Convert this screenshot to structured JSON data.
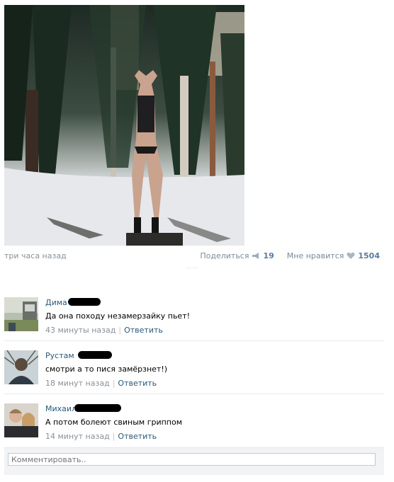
{
  "post": {
    "photo_icon": "forest-photo",
    "time": "три часа назад",
    "share_label": "Поделиться",
    "share_count": "19",
    "like_label": "Мне нравится",
    "like_count": "1504"
  },
  "comments": [
    {
      "author": "Дима",
      "text": "Да она походу незамерзайку пьет!",
      "time": "43 минуты назад",
      "reply": "Ответить"
    },
    {
      "author": "Рустам",
      "text": "смотри а то пися замёрзнет!)",
      "time": "18 минут назад",
      "reply": "Ответить"
    },
    {
      "author": "Михаил",
      "text": "А потом болеют свиным гриппом",
      "time": "14 минут назад",
      "reply": "Ответить"
    }
  ],
  "composer": {
    "placeholder": "Комментировать.."
  },
  "colors": {
    "link": "#2b587a",
    "muted": "#8a9199",
    "count": "#5a7a9e"
  }
}
